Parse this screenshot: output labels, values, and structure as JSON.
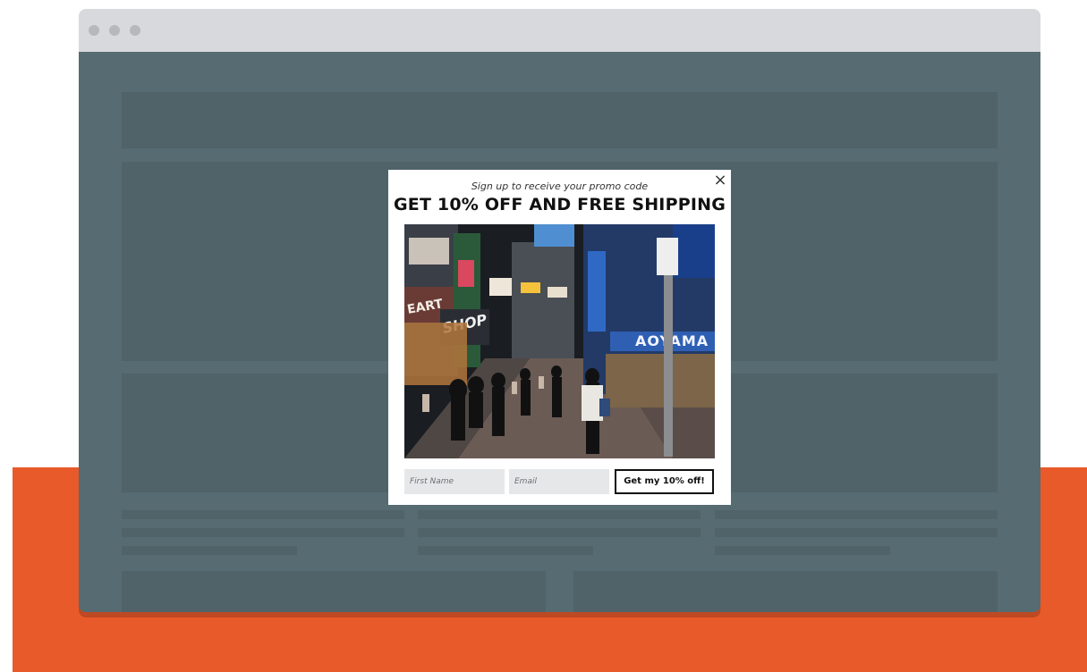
{
  "colors": {
    "accent": "#e85a2a",
    "browser_chrome": "#d8d9dc",
    "page_background": "#566b72",
    "placeholder_block": "#4f6369"
  },
  "popup": {
    "subtitle": "Sign up to receive your promo code",
    "headline": "GET 10% OFF AND FREE SHIPPING",
    "close_icon": "close-icon",
    "image_description": "night street scene with shops and pedestrians",
    "first_name_placeholder": "First Name",
    "email_placeholder": "Email",
    "cta_label": "Get my 10% off!"
  }
}
